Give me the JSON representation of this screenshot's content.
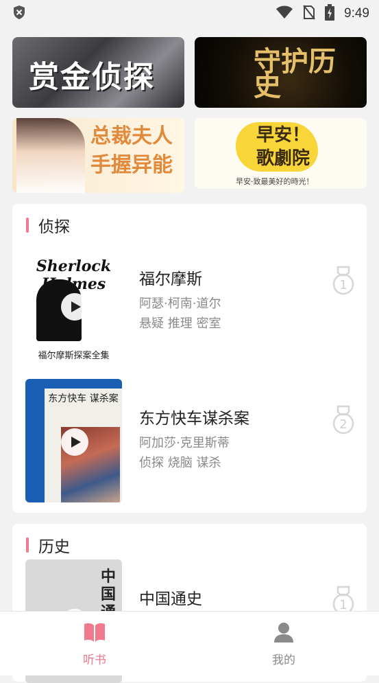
{
  "status_bar": {
    "time": "9:49",
    "icons": [
      "shield-x-icon",
      "wifi-icon",
      "no-sim-icon",
      "battery-charging-icon"
    ]
  },
  "banners": [
    {
      "text": "赏金侦探"
    },
    {
      "text": "守护历史"
    },
    {
      "text": "总裁夫人手握异能"
    },
    {
      "text": "早安！歌劇院",
      "footer": "早安·致最美好的時光！"
    }
  ],
  "sections": [
    {
      "title": "侦探",
      "books": [
        {
          "title": "福尔摩斯",
          "author": "阿瑟·柯南·道尔",
          "tags": "悬疑 推理 密室",
          "rank": "1",
          "cover_title": "Sherlock Holmes",
          "cover_subtitle": "福尔摩斯探案全集"
        },
        {
          "title": "东方快车谋杀案",
          "author": "阿加莎·克里斯蒂",
          "tags": "侦探 烧脑 谋杀",
          "rank": "2",
          "cover_title": "东方快车 谋杀案"
        }
      ]
    },
    {
      "title": "历史",
      "books": [
        {
          "title": "中国通史",
          "rank": "1",
          "cover_title": "中国通"
        }
      ]
    }
  ],
  "bottom_nav": {
    "home_label": "听书",
    "mine_label": "我的",
    "active_color": "#f07a8c",
    "inactive_color": "#8a8a8a"
  }
}
